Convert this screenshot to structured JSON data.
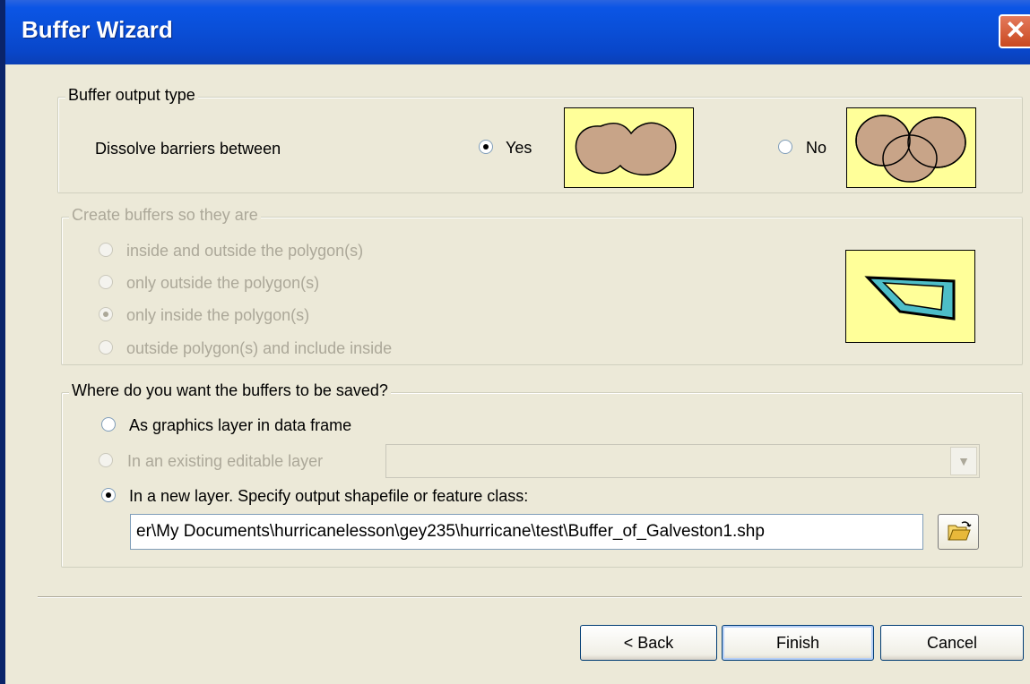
{
  "window": {
    "title": "Buffer Wizard",
    "close_glyph": "✕"
  },
  "output_type": {
    "legend": "Buffer output type",
    "label": "Dissolve barriers between",
    "options": [
      {
        "label": "Yes",
        "checked": true
      },
      {
        "label": "No",
        "checked": false
      }
    ]
  },
  "create_buffers": {
    "legend": "Create buffers so they are",
    "enabled": false,
    "options": [
      {
        "label": "inside and outside the polygon(s)",
        "checked": false
      },
      {
        "label": "only outside the polygon(s)",
        "checked": false
      },
      {
        "label": "only inside the polygon(s)",
        "checked": true
      },
      {
        "label": "outside polygon(s) and include inside",
        "checked": false
      }
    ]
  },
  "save_location": {
    "legend": "Where do you want the buffers to be saved?",
    "options": [
      {
        "label": "As graphics layer in data frame",
        "checked": false,
        "enabled": true
      },
      {
        "label": "In an existing editable layer",
        "checked": false,
        "enabled": false
      },
      {
        "label": "In a new layer.  Specify output shapefile or feature class:",
        "checked": true,
        "enabled": true
      }
    ],
    "layer_combo_value": "",
    "output_path": "er\\My Documents\\hurricanelesson\\gey235\\hurricane\\test\\Buffer_of_Galveston1.shp"
  },
  "buttons": {
    "back": "< Back",
    "finish": "Finish",
    "cancel": "Cancel"
  },
  "icons": {
    "browse": "open-folder-icon",
    "combo": "dropdown-arrow-icon"
  },
  "colors": {
    "titlebar": "#0a4fd8",
    "dialog_bg": "#ece9d8",
    "preview_bg": "#ffff99",
    "buffer_fill": "#c8a488",
    "polygon_buffer": "#4dbec8"
  }
}
